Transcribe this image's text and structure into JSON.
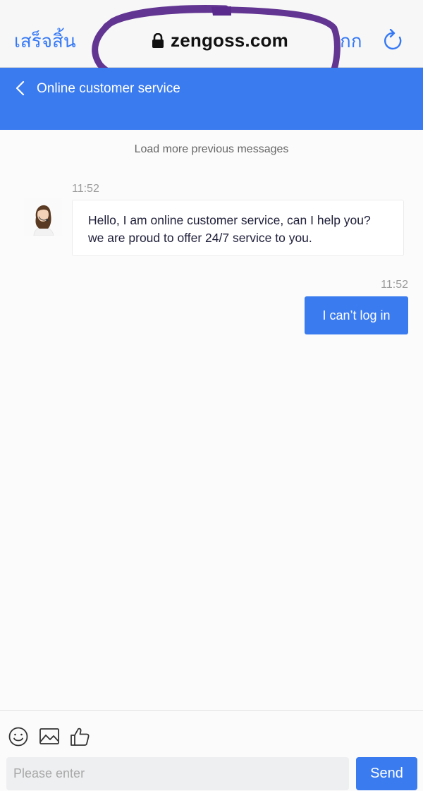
{
  "browser": {
    "done_label": "เสร็จสิ้น",
    "url": "zengoss.com",
    "reader_label": "กก"
  },
  "header": {
    "title": "Online customer service",
    "accent_color": "#3a7bf0"
  },
  "chat": {
    "load_more": "Load more previous messages",
    "messages": [
      {
        "side": "agent",
        "time": "11:52",
        "text": "Hello, I am online customer service, can I help you? we are proud to offer 24/7 service to you."
      },
      {
        "side": "user",
        "time": "11:52",
        "text": "I can’t log in"
      }
    ]
  },
  "composer": {
    "tools": [
      "emoji-icon",
      "image-icon",
      "thumbs-up-icon"
    ],
    "input_placeholder": "Please enter",
    "send_label": "Send"
  }
}
